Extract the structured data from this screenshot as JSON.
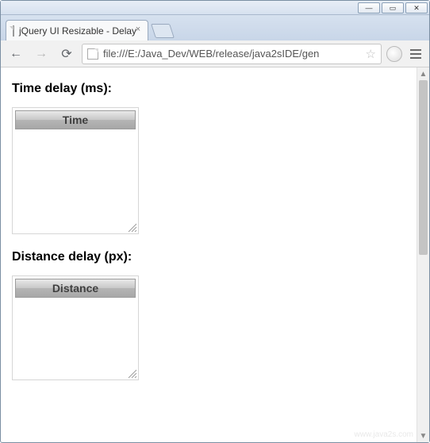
{
  "window": {
    "min": "—",
    "max": "▭",
    "close": "✕"
  },
  "tab": {
    "title": "jQuery UI Resizable - Delay",
    "close": "×"
  },
  "toolbar": {
    "url": "file:///E:/Java_Dev/WEB/release/java2sIDE/gen",
    "back": "←",
    "forward": "→",
    "reload": "⟳",
    "star": "☆"
  },
  "page": {
    "heading_time": "Time delay (ms):",
    "box_time_header": "Time",
    "heading_distance": "Distance delay (px):",
    "box_distance_header": "Distance"
  },
  "watermark": "www.java2s.com"
}
